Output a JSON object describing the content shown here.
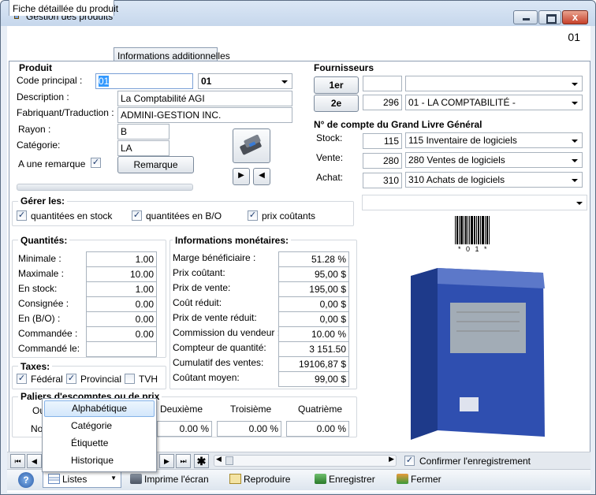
{
  "window": {
    "title": "Gestion des produits",
    "close": "x",
    "record_id": "01"
  },
  "tabs": [
    "Fiche détaillée du produit",
    "Informations additionnelles"
  ],
  "produit": {
    "group_label": "Produit",
    "code_label": "Code principal :",
    "code_value": "01",
    "code_select": "01",
    "description_label": "Description :",
    "description_value": "La Comptabilité AGI",
    "fabriquant_label": "Fabriquant/Traduction :",
    "fabriquant_value": "ADMINI-GESTION INC.",
    "rayon_label": "Rayon :",
    "rayon_value": "B",
    "categorie_label": "Catégorie:",
    "categorie_value": "LA",
    "remarque_label": "A une remarque",
    "remarque_checked": true,
    "remarque_button": "Remarque"
  },
  "fournisseurs": {
    "group_label": "Fournisseurs",
    "btn1": "1er",
    "btn2": "2e",
    "f2_code": "296",
    "f2_select": "01 - LA COMPTABILITÉ -"
  },
  "grand_livre": {
    "group_label": "N° de compte du Grand Livre Général",
    "rows": [
      {
        "label": "Stock:",
        "num": "115",
        "select": "115    Inventaire de logiciels"
      },
      {
        "label": "Vente:",
        "num": "280",
        "select": "280    Ventes de logiciels"
      },
      {
        "label": "Achat:",
        "num": "310",
        "select": "310    Achats de logiciels"
      }
    ]
  },
  "gerer": {
    "group_label": "Gérer les:",
    "items": [
      "quantitées en stock",
      "quantitées en B/O",
      "prix coûtants"
    ]
  },
  "quantites": {
    "group_label": "Quantités:",
    "rows": [
      {
        "label": "Minimale :",
        "value": "1.00"
      },
      {
        "label": "Maximale :",
        "value": "10.00"
      },
      {
        "label": "En stock:",
        "value": "1.00"
      },
      {
        "label": "Consignée :",
        "value": "0.00"
      },
      {
        "label": "En (B/O) :",
        "value": "0.00"
      },
      {
        "label": "Commandée :",
        "value": "0.00"
      },
      {
        "label": "Commandé le:",
        "value": ""
      }
    ]
  },
  "monetaires": {
    "group_label": "Informations monétaires:",
    "rows": [
      {
        "label": "Marge bénéficiaire :",
        "value": "51.28 %"
      },
      {
        "label": "Prix coûtant:",
        "value": "95,00 $"
      },
      {
        "label": "Prix de vente:",
        "value": "195,00 $"
      },
      {
        "label": "Coût réduit:",
        "value": "0,00 $"
      },
      {
        "label": "Prix de vente réduit:",
        "value": "0,00 $"
      },
      {
        "label": "Commission du vendeur :",
        "value": "10.00 %"
      },
      {
        "label": "Compteur de quantité:",
        "value": "3 151.50"
      },
      {
        "label": "Cumulatif des ventes:",
        "value": "19106,87 $"
      },
      {
        "label": "Coûtant moyen:",
        "value": "99,00 $"
      }
    ]
  },
  "taxes": {
    "group_label": "Taxes:",
    "items": [
      {
        "label": "Fédéral",
        "checked": true
      },
      {
        "label": "Provincial",
        "checked": true
      },
      {
        "label": "TVH",
        "checked": false
      }
    ]
  },
  "paliers": {
    "group_label": "Paliers d'escomptes ou de prix",
    "col1": "Ou",
    "col2": "Deuxième",
    "col3": "Troisième",
    "col4": "Quatrième",
    "row_label": "Nor",
    "v2": "0.00 %",
    "v3": "0.00 %",
    "v4": "0.00 %"
  },
  "barcode": {
    "text": "* 0 1 *"
  },
  "listes_menu": [
    "Alphabétique",
    "Catégorie",
    "Étiquette",
    "Historique"
  ],
  "nav": {
    "first": "⏮",
    "prev": "◀",
    "next": "▶",
    "last": "⏭",
    "new": "✱",
    "confirm_label": "Confirmer l'enregistrement",
    "confirm_checked": true
  },
  "toolbar": {
    "listes": "Listes",
    "imprime": "Imprime l'écran",
    "reproduire": "Reproduire",
    "enregistrer": "Enregistrer",
    "fermer": "Fermer"
  },
  "colors": {
    "accent": "#3399ff",
    "titlebar": "#c6d7ec",
    "close": "#c6412b"
  }
}
